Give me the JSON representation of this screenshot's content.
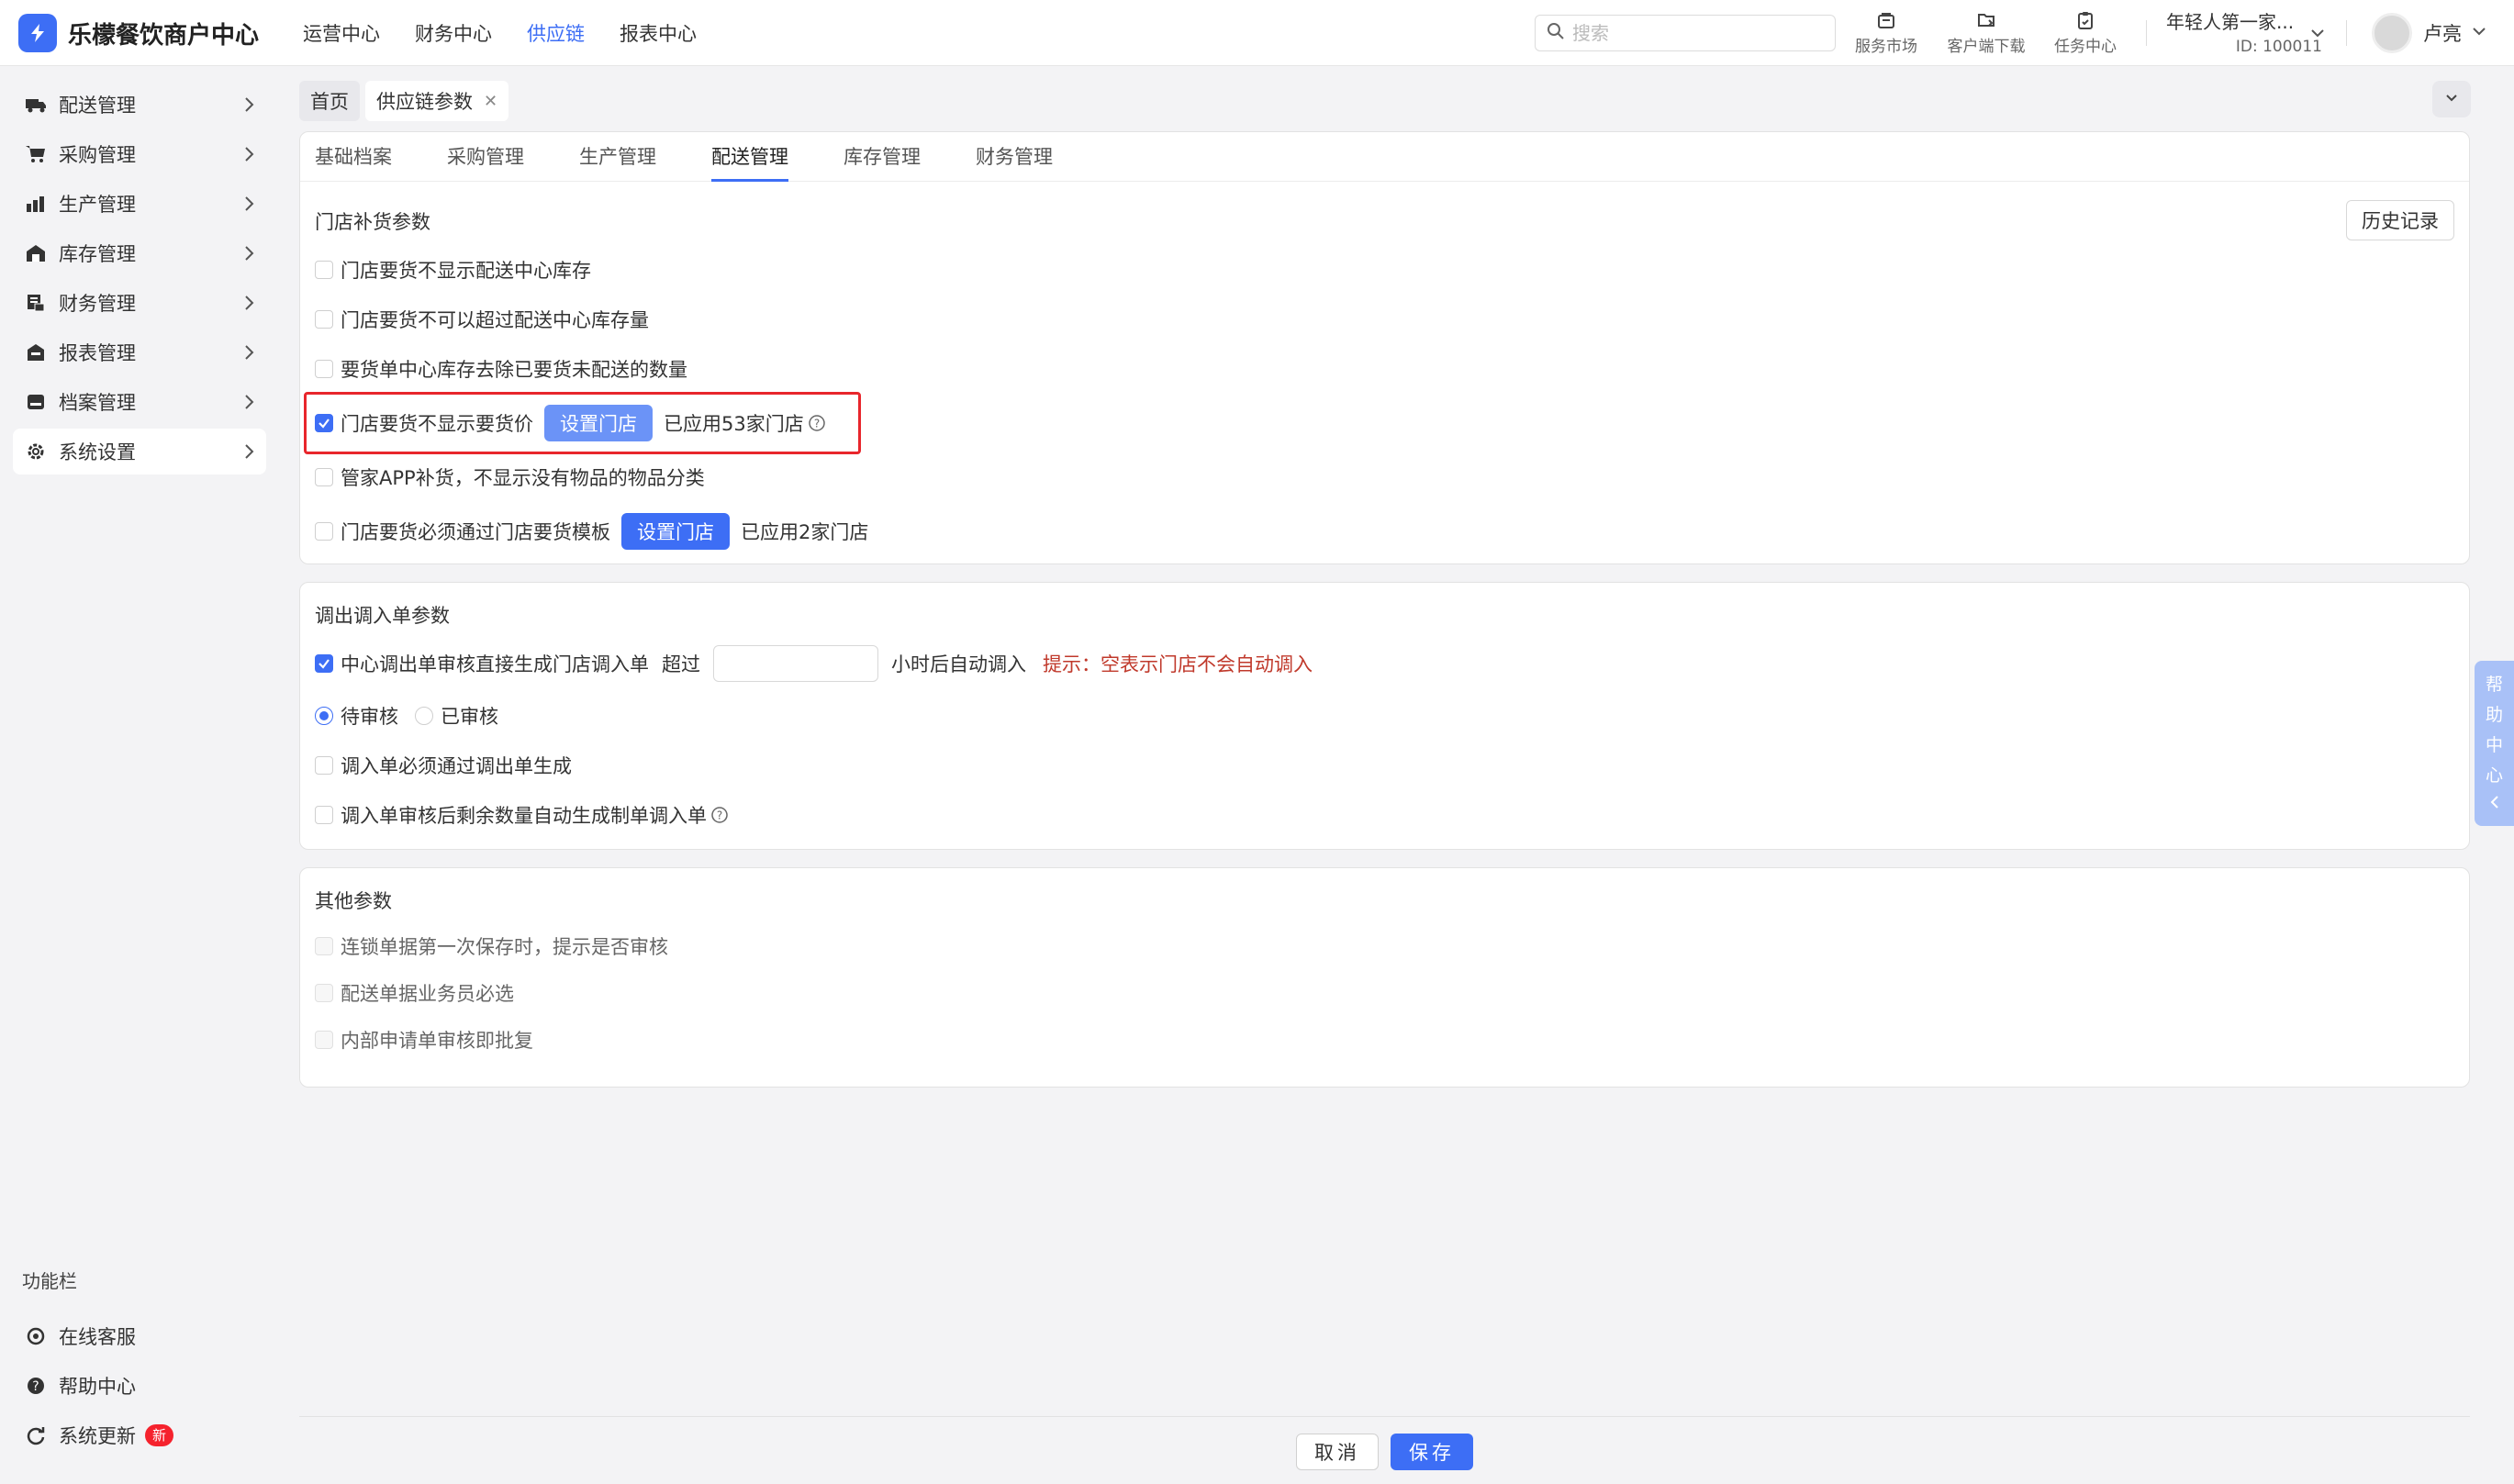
{
  "app": {
    "title": "乐檬餐饮商户中心"
  },
  "topnav": [
    {
      "label": "运营中心",
      "active": false
    },
    {
      "label": "财务中心",
      "active": false
    },
    {
      "label": "供应链",
      "active": true
    },
    {
      "label": "报表中心",
      "active": false
    }
  ],
  "search": {
    "placeholder": "搜索"
  },
  "tools": [
    {
      "label": "服务市场",
      "icon": "store-icon"
    },
    {
      "label": "客户端下载",
      "icon": "download-folder-icon"
    },
    {
      "label": "任务中心",
      "icon": "clipboard-icon"
    }
  ],
  "org": {
    "name": "年轻人第一家...",
    "id": "ID: 100011"
  },
  "user": {
    "name": "卢亮"
  },
  "sidebar": {
    "items": [
      {
        "label": "配送管理",
        "icon": "truck-icon"
      },
      {
        "label": "采购管理",
        "icon": "cart-icon"
      },
      {
        "label": "生产管理",
        "icon": "factory-icon"
      },
      {
        "label": "库存管理",
        "icon": "warehouse-icon"
      },
      {
        "label": "财务管理",
        "icon": "finance-icon"
      },
      {
        "label": "报表管理",
        "icon": "report-icon"
      },
      {
        "label": "档案管理",
        "icon": "archive-icon"
      },
      {
        "label": "系统设置",
        "icon": "gear-icon",
        "active": true
      }
    ],
    "footer_title": "功能栏",
    "footer_items": [
      {
        "label": "在线客服",
        "icon": "headset-icon"
      },
      {
        "label": "帮助中心",
        "icon": "help-icon"
      },
      {
        "label": "系统更新",
        "icon": "refresh-icon",
        "badge": "新"
      }
    ]
  },
  "page_tabs": [
    {
      "label": "首页"
    },
    {
      "label": "供应链参数",
      "closable": true
    }
  ],
  "category_tabs": [
    {
      "label": "基础档案"
    },
    {
      "label": "采购管理"
    },
    {
      "label": "生产管理"
    },
    {
      "label": "配送管理",
      "active": true
    },
    {
      "label": "库存管理"
    },
    {
      "label": "财务管理"
    }
  ],
  "section1": {
    "title": "门店补货参数",
    "history_button": "历史记录",
    "options": [
      {
        "label": "门店要货不显示配送中心库存",
        "checked": false
      },
      {
        "label": "门店要货不可以超过配送中心库存量",
        "checked": false
      },
      {
        "label": "要货单中心库存去除已要货未配送的数量",
        "checked": false
      },
      {
        "label": "门店要货不显示要货价",
        "checked": true,
        "button": "设置门店",
        "applied": "已应用53家门店",
        "help": true
      },
      {
        "label": "管家APP补货，不显示没有物品的物品分类",
        "checked": false
      },
      {
        "label": "门店要货必须通过门店要货模板",
        "checked": false,
        "button": "设置门店",
        "applied": "已应用2家门店"
      }
    ]
  },
  "section2": {
    "title": "调出调入单参数",
    "auto_row": {
      "label": "中心调出单审核直接生成门店调入单",
      "checked": true,
      "over_label": "超过",
      "hours_value": "",
      "after_label": "小时后自动调入",
      "hint": "提示：空表示门店不会自动调入"
    },
    "radios": [
      {
        "label": "待审核",
        "checked": true
      },
      {
        "label": "已审核",
        "checked": false
      }
    ],
    "options": [
      {
        "label": "调入单必须通过调出单生成",
        "checked": false
      },
      {
        "label": "调入单审核后剩余数量自动生成制单调入单",
        "checked": false,
        "help": true
      }
    ]
  },
  "section3": {
    "title": "其他参数",
    "options": [
      {
        "label": "连锁单据第一次保存时，提示是否审核",
        "disabled": true
      },
      {
        "label": "配送单据业务员必选",
        "disabled": true
      },
      {
        "label": "内部申请单审核即批复",
        "disabled": true
      }
    ]
  },
  "footer": {
    "cancel": "取消",
    "save": "保存"
  },
  "help_float": {
    "chars": [
      "帮",
      "助",
      "中",
      "心"
    ]
  },
  "colors": {
    "accent": "#3d6ef5",
    "highlight_border": "#e8262c",
    "hint": "#c0392b"
  }
}
